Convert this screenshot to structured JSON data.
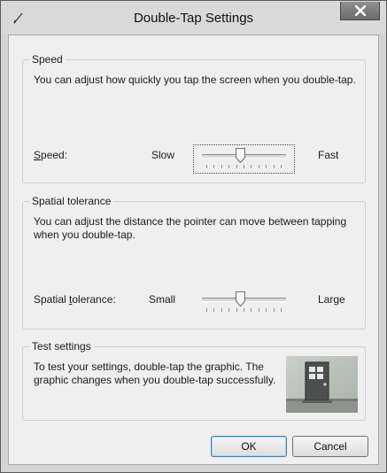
{
  "window": {
    "title": "Double-Tap Settings"
  },
  "speed": {
    "legend": "Speed",
    "description": "You can adjust how quickly you tap the screen when you double-tap.",
    "label_pre": "",
    "label_access_key": "S",
    "label_post": "peed:",
    "min_label": "Slow",
    "max_label": "Fast",
    "value": 0.45
  },
  "tolerance": {
    "legend": "Spatial tolerance",
    "description": "You can adjust the distance the pointer can move between tapping when you double-tap.",
    "label_pre": "Spatial ",
    "label_access_key": "t",
    "label_post": "olerance:",
    "min_label": "Small",
    "max_label": "Large",
    "value": 0.45
  },
  "test": {
    "legend": "Test settings",
    "description": "To test your settings, double-tap the graphic. The graphic changes when you double-tap successfully."
  },
  "buttons": {
    "ok": "OK",
    "cancel": "Cancel"
  },
  "colors": {
    "default_button_border": "#3c7fb1",
    "close_button": "#7a7a7a"
  }
}
